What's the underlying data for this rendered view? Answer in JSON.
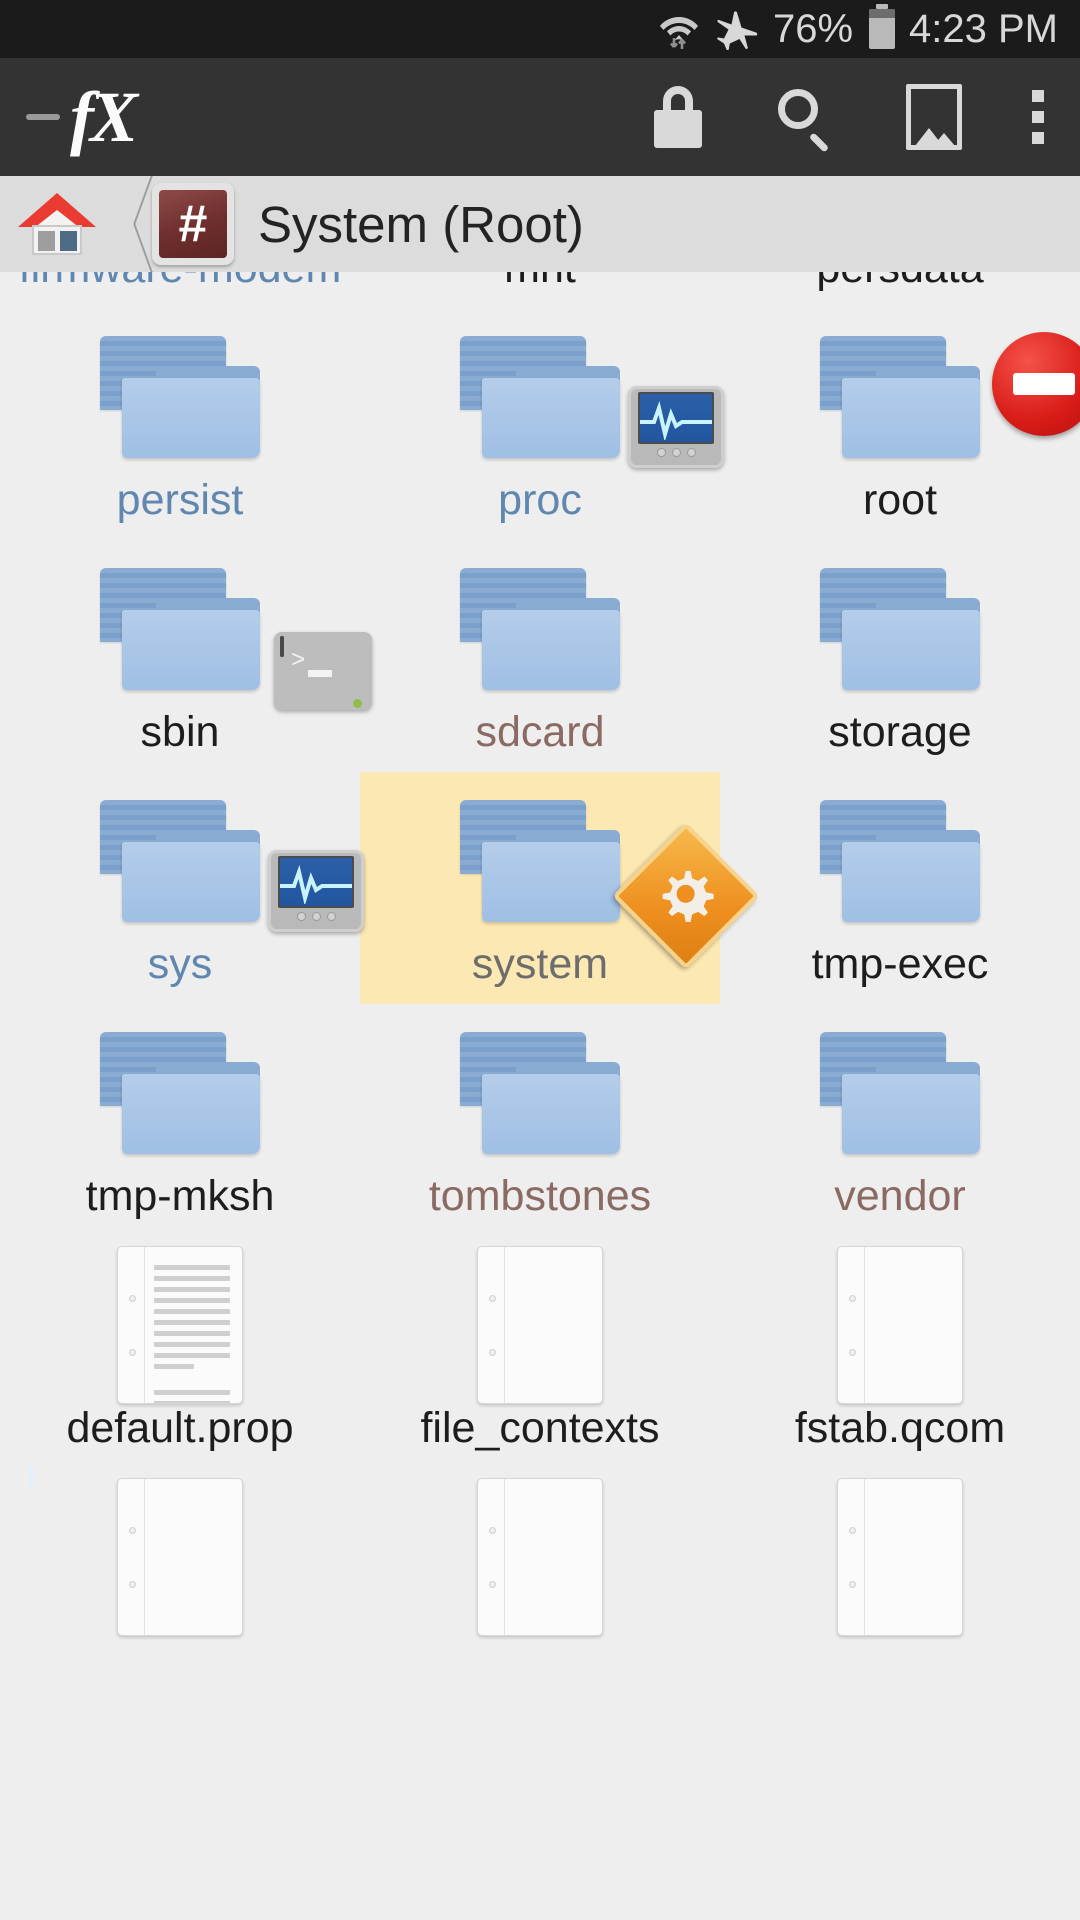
{
  "status_bar": {
    "wifi_icon": "wifi-with-transfer-arrows-icon",
    "airplane_icon": "airplane-mode-icon",
    "battery_percent": "76%",
    "battery_icon": "battery-icon",
    "clock": "4:23 PM"
  },
  "app_bar": {
    "back_label": "",
    "logo_text": "fX",
    "actions": [
      {
        "name": "lock-icon",
        "label": "Lock"
      },
      {
        "name": "search-icon",
        "label": "Search"
      },
      {
        "name": "image-icon",
        "label": "Images"
      },
      {
        "name": "overflow-menu-icon",
        "label": "More options"
      }
    ]
  },
  "breadcrumb": {
    "home_label": "Home",
    "root_badge": "#",
    "current_label": "System (Root)"
  },
  "grid": {
    "items": [
      {
        "name": "firmware-modem",
        "type": "folder",
        "style": "link",
        "badge": "none"
      },
      {
        "name": "mnt",
        "type": "folder",
        "style": "plain",
        "badge": "none"
      },
      {
        "name": "persdata",
        "type": "folder",
        "style": "plain",
        "badge": "none"
      },
      {
        "name": "persist",
        "type": "folder",
        "style": "link",
        "badge": "none"
      },
      {
        "name": "proc",
        "type": "folder",
        "style": "link",
        "badge": "monitor"
      },
      {
        "name": "root",
        "type": "folder",
        "style": "plain",
        "badge": "noentry"
      },
      {
        "name": "sbin",
        "type": "folder",
        "style": "plain",
        "badge": "terminal"
      },
      {
        "name": "sdcard",
        "type": "folder",
        "style": "sym",
        "badge": "none"
      },
      {
        "name": "storage",
        "type": "folder",
        "style": "plain",
        "badge": "none"
      },
      {
        "name": "sys",
        "type": "folder",
        "style": "link",
        "badge": "monitor"
      },
      {
        "name": "system",
        "type": "folder",
        "style": "selected",
        "badge": "gear",
        "selected": true
      },
      {
        "name": "tmp-exec",
        "type": "folder",
        "style": "plain",
        "badge": "none"
      },
      {
        "name": "tmp-mksh",
        "type": "folder",
        "style": "plain",
        "badge": "none"
      },
      {
        "name": "tombstones",
        "type": "folder",
        "style": "sym",
        "badge": "none"
      },
      {
        "name": "vendor",
        "type": "folder",
        "style": "sym",
        "badge": "none"
      },
      {
        "name": "default.prop",
        "type": "file-text",
        "style": "plain",
        "badge": "none"
      },
      {
        "name": "file_contexts",
        "type": "file-blank",
        "style": "plain",
        "badge": "none"
      },
      {
        "name": "fstab.qcom",
        "type": "file-blank",
        "style": "plain",
        "badge": "none"
      },
      {
        "name": "",
        "type": "file-xml",
        "style": "plain",
        "badge": "none"
      },
      {
        "name": "",
        "type": "file-blank",
        "style": "plain",
        "badge": "none"
      },
      {
        "name": "",
        "type": "file-blank",
        "style": "plain",
        "badge": "none"
      }
    ]
  },
  "colors": {
    "status_bar_bg": "#1b1b1b",
    "app_bar_bg": "#333333",
    "breadcrumb_bg": "#dcdcdc",
    "content_bg": "#eeeeee",
    "selection_bg": "#fce8b2",
    "link_text": "#5f87b0",
    "plain_text": "#1d1d1d",
    "symlink_text": "#8a6a62",
    "root_badge_bg": "#6e2e2d"
  }
}
